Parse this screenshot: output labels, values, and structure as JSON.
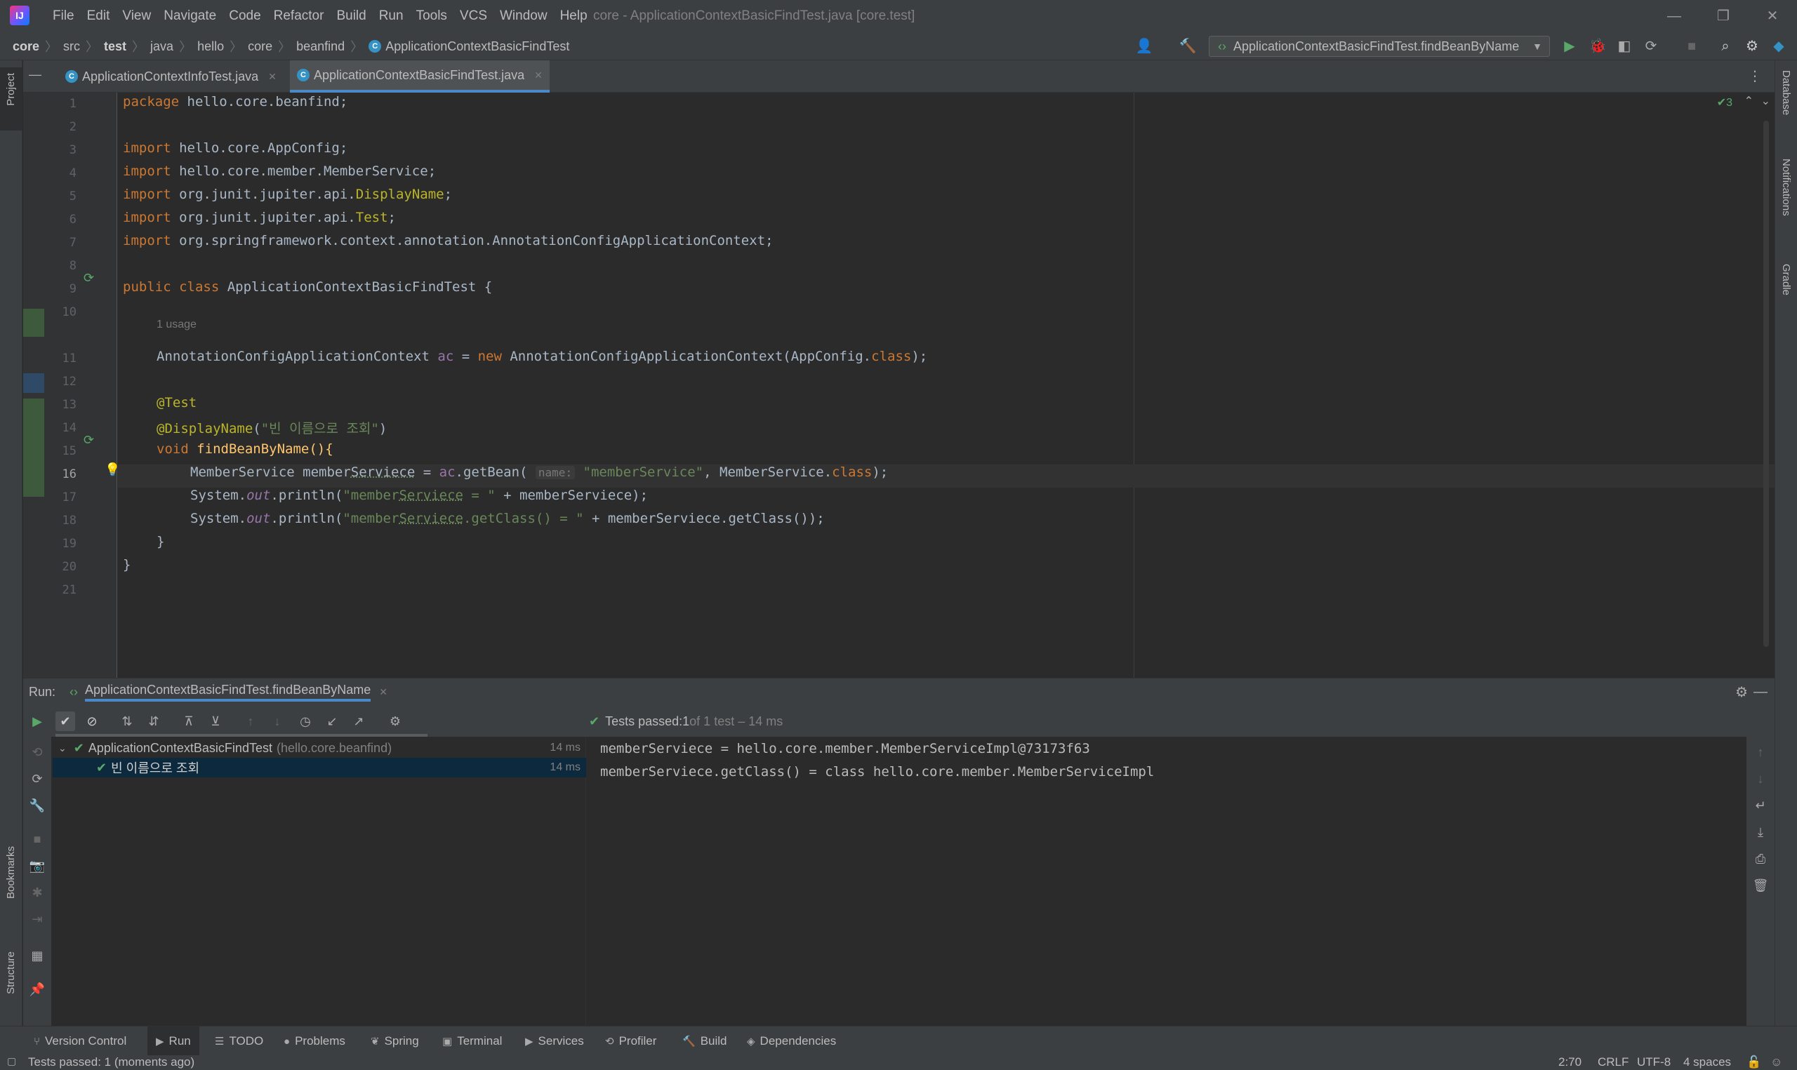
{
  "app": {
    "logo": "IJ",
    "menu": [
      "File",
      "Edit",
      "View",
      "Navigate",
      "Code",
      "Refactor",
      "Build",
      "Run",
      "Tools",
      "VCS",
      "Window",
      "Help"
    ],
    "window_title": "core - ApplicationContextBasicFindTest.java [core.test]",
    "window_controls": {
      "minimize": "—",
      "restore": "❐",
      "close": "✕"
    }
  },
  "breadcrumbs": [
    "core",
    "src",
    "test",
    "java",
    "hello",
    "core",
    "beanfind",
    "ApplicationContextBasicFindTest"
  ],
  "run_config": "ApplicationContextBasicFindTest.findBeanByName",
  "left_tools": {
    "project": "Project",
    "bookmarks": "Bookmarks",
    "structure": "Structure"
  },
  "right_tools": {
    "database": "Database",
    "notifications": "Notifications",
    "gradle": "Gradle"
  },
  "tabs": [
    {
      "label": "ApplicationContextInfoTest.java",
      "active": false
    },
    {
      "label": "ApplicationContextBasicFindTest.java",
      "active": true
    }
  ],
  "inspections": "✔3",
  "editor": {
    "usage_hint": "1 usage",
    "param_hint": "name:",
    "line_numbers": [
      "1",
      "2",
      "3",
      "4",
      "5",
      "6",
      "7",
      "8",
      "9",
      "10",
      "11",
      "12",
      "13",
      "14",
      "15",
      "16",
      "17",
      "18",
      "19",
      "20",
      "21"
    ],
    "lines": {
      "l1": {
        "kw": "package",
        "rest": " hello.core.beanfind;"
      },
      "l3": {
        "kw": "import",
        "rest": " hello.core.AppConfig;"
      },
      "l4": {
        "kw": "import",
        "rest": " hello.core.member.MemberService;"
      },
      "l5": {
        "kw": "import",
        "pre": " org.junit.jupiter.api.",
        "ann": "DisplayName",
        "post": ";"
      },
      "l6": {
        "kw": "import",
        "pre": " org.junit.jupiter.api.",
        "ann": "Test",
        "post": ";"
      },
      "l7": {
        "kw": "import",
        "rest": " org.springframework.context.annotation.AnnotationConfigApplicationContext;"
      },
      "l9": {
        "kw1": "public",
        "kw2": " class",
        "rest": " ApplicationContextBasicFindTest {"
      },
      "l11": {
        "a": "AnnotationConfigApplicationContext ",
        "b": "ac",
        "c": " = ",
        "kw": "new",
        "d": " AnnotationConfigApplicationContext(AppConfig.",
        "e": "class",
        "f": ");"
      },
      "l13": {
        "ann": "@Test"
      },
      "l14": {
        "ann": "@DisplayName",
        "p1": "(",
        "str": "\"빈 이름으로 조회\"",
        "p2": ")"
      },
      "l15": {
        "kw": "void",
        "rest": " findBeanByName(){"
      },
      "l16": {
        "a": "MemberService member",
        "u": "Serviece",
        "b": " = ",
        "c": "ac",
        "d": ".getBean( ",
        "str": "\"memberService\"",
        "e": ", MemberService.",
        "kw": "class",
        "f": ");"
      },
      "l17": {
        "a": "System.",
        "it": "out",
        "b": ".println(",
        "s1": "\"member",
        "u": "Serviece",
        "s2": " = \"",
        "c": " + memberServiece);"
      },
      "l18": {
        "a": "System.",
        "it": "out",
        "b": ".println(",
        "s1": "\"member",
        "u": "Serviece",
        "s2": ".getClass() = \"",
        "c": " + memberServiece.getClass());"
      },
      "l19": {
        "rest": "}"
      },
      "l20": {
        "rest": "}"
      }
    }
  },
  "run_panel": {
    "label": "Run:",
    "tab": "ApplicationContextBasicFindTest.findBeanByName",
    "status_prefix": "Tests passed: ",
    "status_count": "1",
    "status_suffix": " of 1 test – 14 ms",
    "tree": [
      {
        "name": "ApplicationContextBasicFindTest",
        "pkg": "(hello.core.beanfind)",
        "time": "14 ms"
      },
      {
        "name": "빈 이름으로 조회",
        "time": "14 ms"
      }
    ],
    "console": [
      "memberServiece = hello.core.member.MemberServiceImpl@73173f63",
      "memberServiece.getClass() = class hello.core.member.MemberServiceImpl"
    ]
  },
  "bottom_tabs": [
    "Version Control",
    "Run",
    "TODO",
    "Problems",
    "Spring",
    "Terminal",
    "Services",
    "Profiler",
    "Build",
    "Dependencies"
  ],
  "status": {
    "message": "Tests passed: 1 (moments ago)",
    "position": "2:70",
    "line_sep": "CRLF",
    "encoding": "UTF-8",
    "indent": "4 spaces"
  },
  "colors": {
    "accent": "#4a88c7",
    "keyword": "#cc7832",
    "string": "#6a8759",
    "annotation": "#bbb529",
    "pass": "#59a869"
  }
}
